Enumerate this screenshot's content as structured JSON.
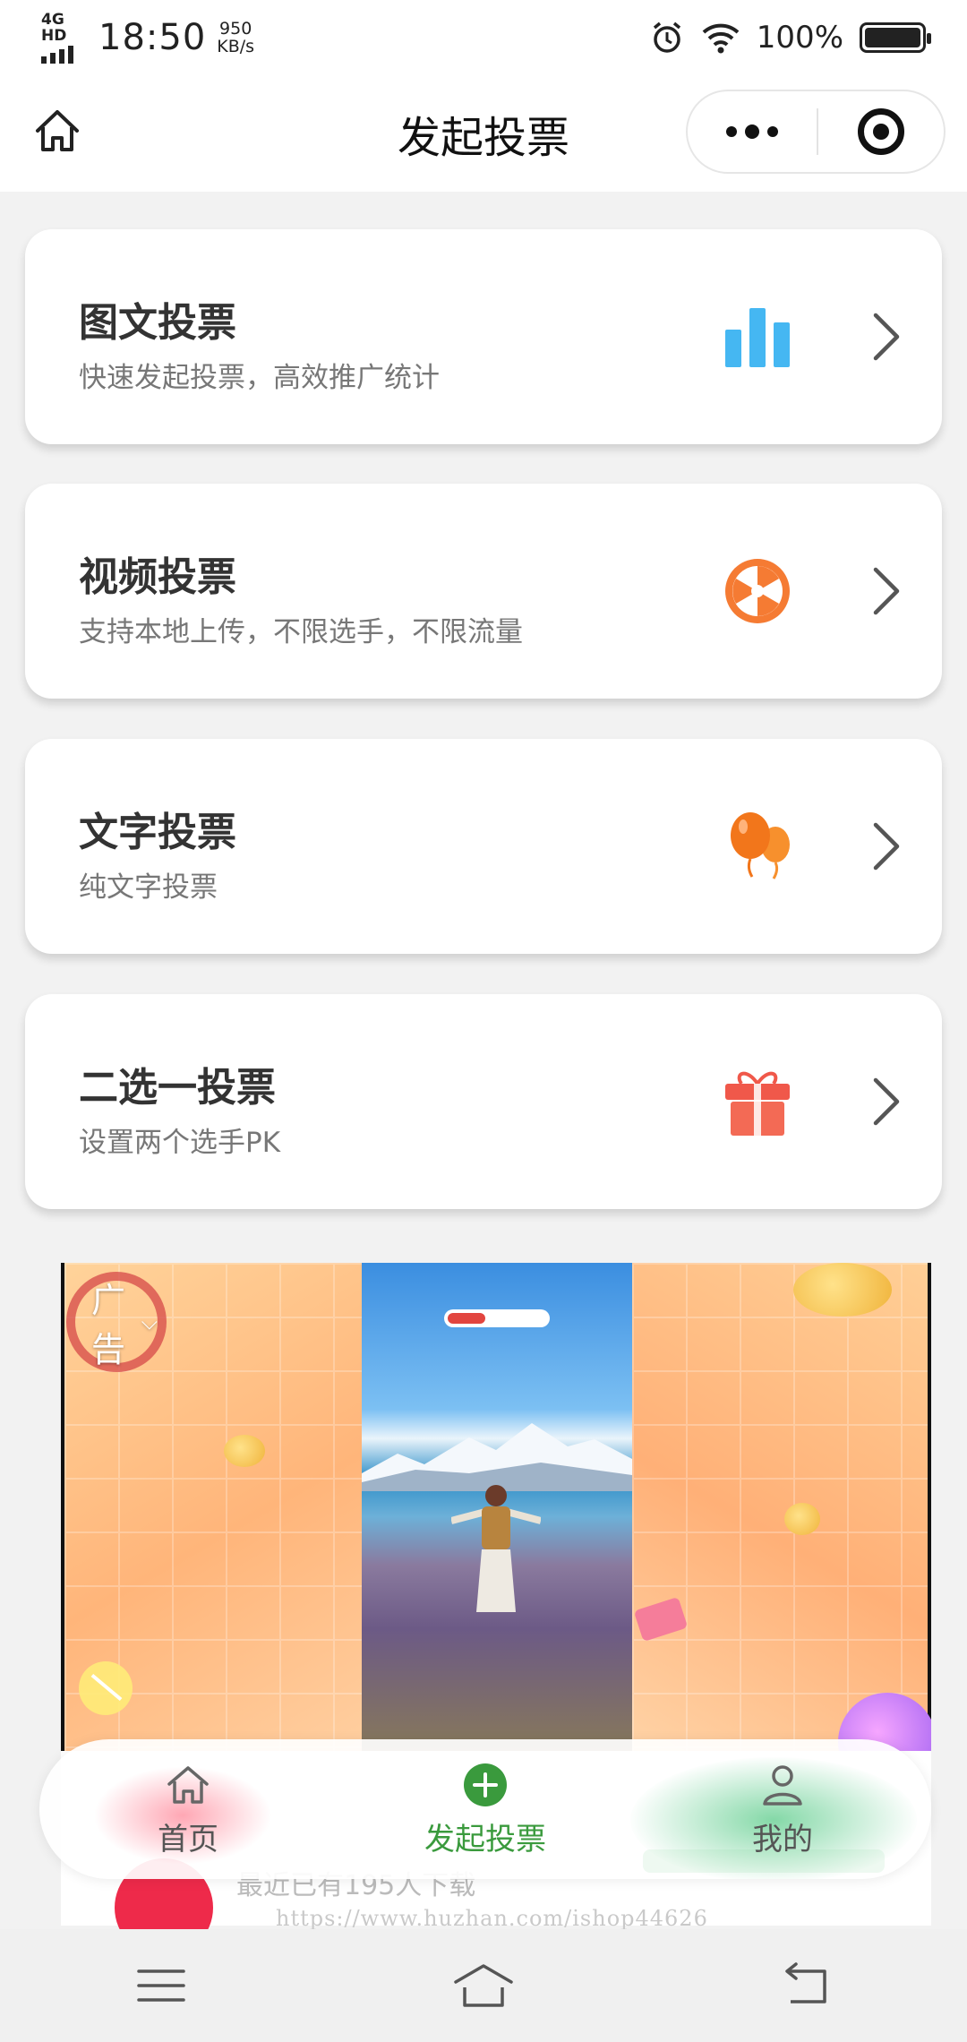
{
  "status_bar": {
    "network": "4G HD",
    "time": "18:50",
    "speed_value": "950",
    "speed_unit": "KB/s",
    "battery": "100%",
    "icons": [
      "alarm-icon",
      "wifi-icon",
      "battery-icon"
    ]
  },
  "nav": {
    "title": "发起投票",
    "home_icon": "home-outline-icon",
    "more_icon": "more-dots-icon",
    "close_icon": "target-circle-icon"
  },
  "vote_types": [
    {
      "title": "图文投票",
      "subtitle": "快速发起投票，高效推广统计",
      "icon": "bar-chart-icon",
      "color": "#3aaef0"
    },
    {
      "title": "视频投票",
      "subtitle": "支持本地上传，不限选手，不限流量",
      "icon": "film-reel-icon",
      "color": "#f57b33"
    },
    {
      "title": "文字投票",
      "subtitle": "纯文字投票",
      "icon": "balloons-icon",
      "color": "#f27a1e"
    },
    {
      "title": "二选一投票",
      "subtitle": "设置两个选手PK",
      "icon": "gift-box-icon",
      "color": "#f0584a"
    }
  ],
  "ad": {
    "badge": "广告",
    "caret": "⌵",
    "footer_text": "最近已有195人下载"
  },
  "tabbar": {
    "items": [
      {
        "label": "首页",
        "icon": "home-icon",
        "active": false
      },
      {
        "label": "发起投票",
        "icon": "plus-circle-icon",
        "active": true
      },
      {
        "label": "我的",
        "icon": "user-icon",
        "active": false
      }
    ],
    "accent": "#3a9a3d"
  },
  "watermark": "https://www.huzhan.com/ishop44626",
  "system_nav": [
    "menu-icon",
    "home-icon",
    "back-icon"
  ]
}
